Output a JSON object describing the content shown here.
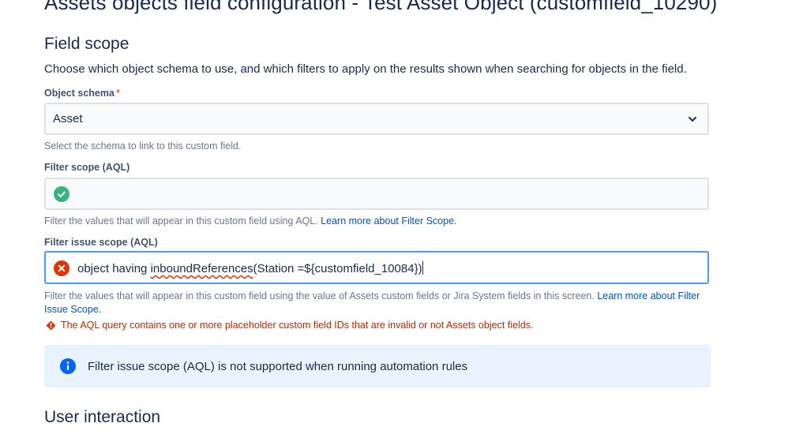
{
  "page": {
    "title": "Assets objects field configuration - Test Asset Object (customfield_10290)"
  },
  "field_scope": {
    "heading": "Field scope",
    "description": "Choose which object schema to use, and which filters to apply on the results shown when searching for objects in the field.",
    "object_schema": {
      "label": "Object schema",
      "required_mark": "*",
      "value": "Asset",
      "helper": "Select the schema to link to this custom field."
    },
    "filter_scope": {
      "label": "Filter scope (AQL)",
      "value": "",
      "status": "valid",
      "helper": "Filter the values that will appear in this custom field using AQL.",
      "link": "Learn more about Filter Scope."
    },
    "filter_issue_scope": {
      "label": "Filter issue scope (AQL)",
      "value_prefix": "object having ",
      "value_flagged": "inboundReferences",
      "value_suffix": "(Station =${customfield_10084})",
      "status": "invalid",
      "helper": "Filter the values that will appear in this custom field using the value of Assets custom fields or Jira System fields in this screen.",
      "link": "Learn more about Filter Issue Scope.",
      "error": "The AQL query contains one or more placeholder custom field IDs that are invalid or not Assets object fields."
    },
    "info_banner": "Filter issue scope (AQL) is not supported when running automation rules"
  },
  "user_interaction": {
    "heading": "User interaction"
  },
  "colors": {
    "text": "#172b4d",
    "link": "#0052cc",
    "success": "#36b37e",
    "error": "#de350b",
    "error_text": "#bf2600",
    "info": "#0065ff",
    "info_bg": "#e9f2ff",
    "focus_border": "#4c9aff"
  },
  "icons": {
    "dropdown": "chevron-down-icon",
    "valid": "check-circle-icon",
    "invalid": "cross-circle-icon",
    "error": "error-diamond-icon",
    "info": "info-circle-icon"
  }
}
